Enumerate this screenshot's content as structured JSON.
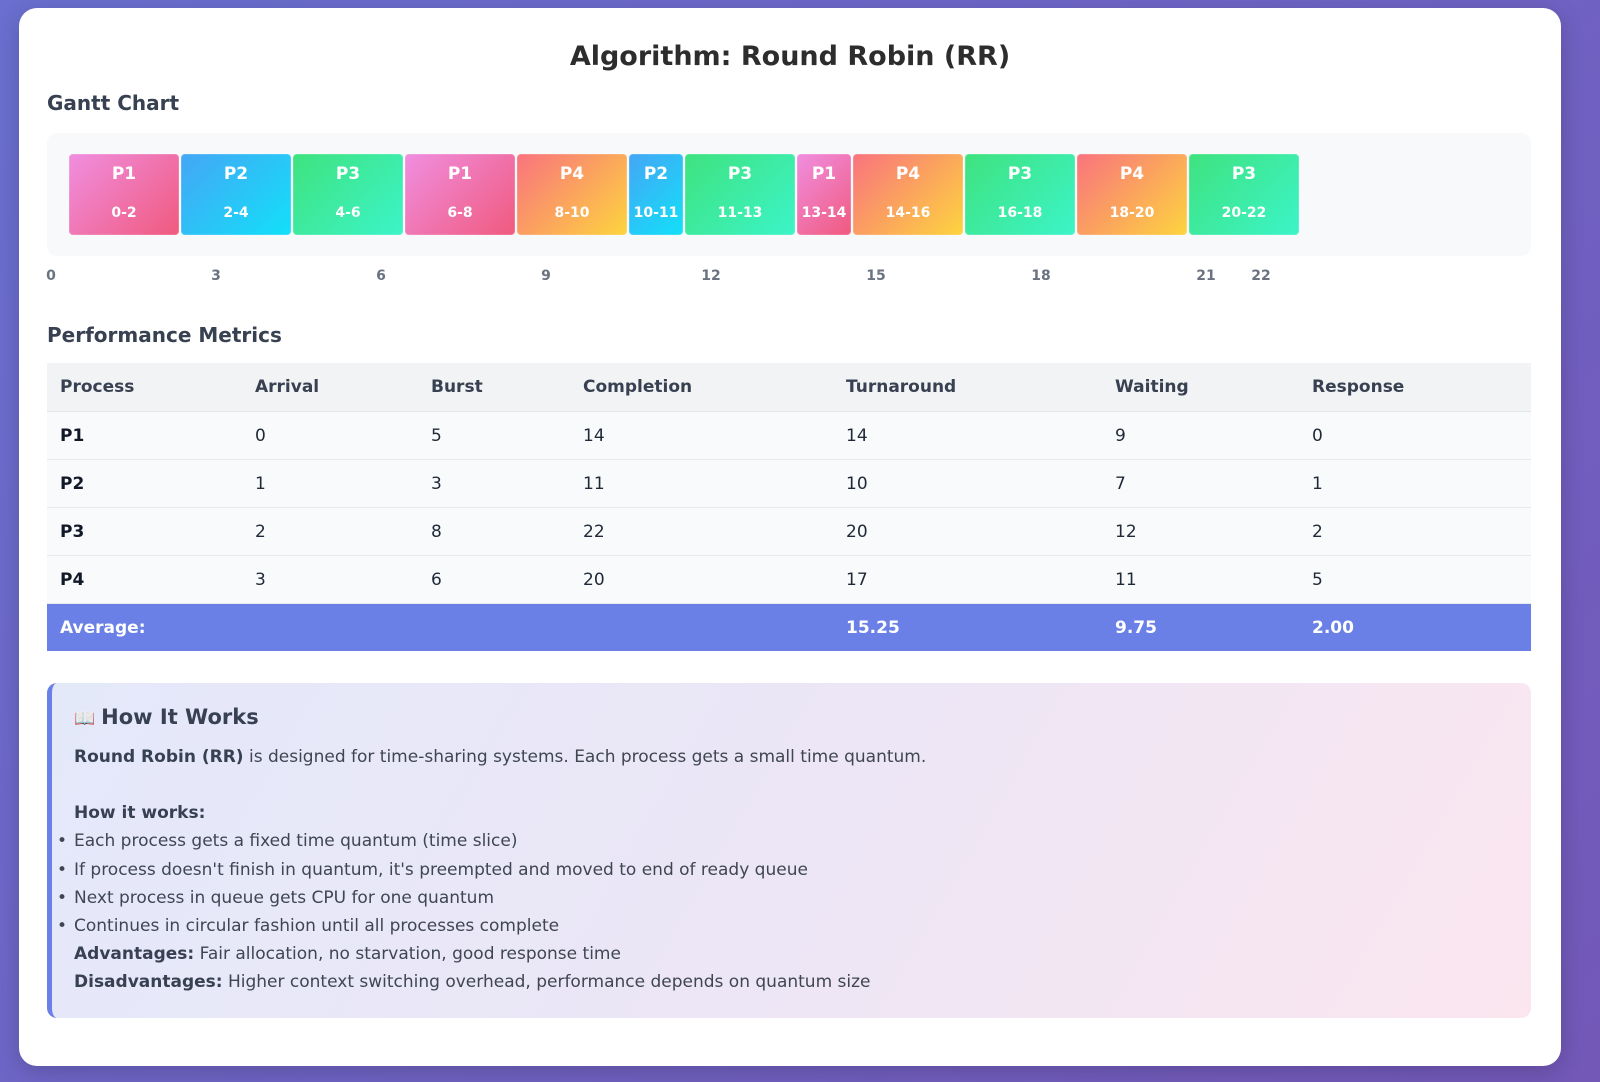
{
  "title": "Algorithm: Round Robin (RR)",
  "gantt": {
    "heading": "Gantt Chart",
    "blocks": [
      {
        "process": "P1",
        "range": "0-2"
      },
      {
        "process": "P2",
        "range": "2-4"
      },
      {
        "process": "P3",
        "range": "4-6"
      },
      {
        "process": "P1",
        "range": "6-8"
      },
      {
        "process": "P4",
        "range": "8-10"
      },
      {
        "process": "P2",
        "range": "10-11"
      },
      {
        "process": "P3",
        "range": "11-13"
      },
      {
        "process": "P1",
        "range": "13-14"
      },
      {
        "process": "P4",
        "range": "14-16"
      },
      {
        "process": "P3",
        "range": "16-18"
      },
      {
        "process": "P4",
        "range": "18-20"
      },
      {
        "process": "P3",
        "range": "20-22"
      }
    ],
    "ticks": [
      "0",
      "3",
      "6",
      "9",
      "12",
      "15",
      "18",
      "21",
      "22"
    ],
    "colors": {
      "P1": [
        "#f08ee0",
        "#f05a7e"
      ],
      "P2": [
        "#45a6f5",
        "#12e0f8"
      ],
      "P3": [
        "#3ee27e",
        "#3cf4c8"
      ],
      "P4": [
        "#f9737e",
        "#fdd43e"
      ]
    }
  },
  "metrics": {
    "heading": "Performance Metrics",
    "columns": [
      "Process",
      "Arrival",
      "Burst",
      "Completion",
      "Turnaround",
      "Waiting",
      "Response"
    ],
    "rows": [
      [
        "P1",
        "0",
        "5",
        "14",
        "14",
        "9",
        "0"
      ],
      [
        "P2",
        "1",
        "3",
        "11",
        "10",
        "7",
        "1"
      ],
      [
        "P3",
        "2",
        "8",
        "22",
        "20",
        "12",
        "2"
      ],
      [
        "P4",
        "3",
        "6",
        "20",
        "17",
        "11",
        "5"
      ]
    ],
    "average": {
      "label": "Average:",
      "turnaround": "15.25",
      "waiting": "9.75",
      "response": "2.00"
    }
  },
  "info": {
    "icon": "📖",
    "heading": "How It Works",
    "intro_bold": "Round Robin (RR)",
    "intro_text": " is designed for time-sharing systems. Each process gets a small time quantum.",
    "how_label": "How it works:",
    "bullets": [
      "Each process gets a fixed time quantum (time slice)",
      "If process doesn't finish in quantum, it's preempted and moved to end of ready queue",
      "Next process in queue gets CPU for one quantum",
      "Continues in circular fashion until all processes complete"
    ],
    "advantages_label": "Advantages:",
    "advantages_text": " Fair allocation, no starvation, good response time",
    "disadvantages_label": "Disadvantages:",
    "disadvantages_text": " Higher context switching overhead, performance depends on quantum size"
  }
}
